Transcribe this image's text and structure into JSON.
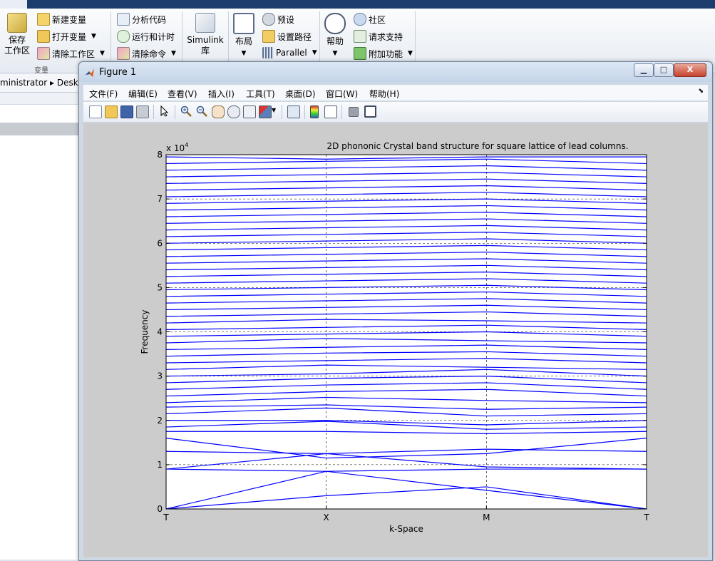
{
  "ribbon": {
    "variable_group": {
      "save_workspace": "保存\n工作区",
      "new_variable": "新建变量",
      "open_variable": "打开变量",
      "clear_workspace": "清除工作区",
      "group_label": "变量"
    },
    "code_group": {
      "analyze_code": "分析代码",
      "run_and_time": "运行和计时",
      "clear_commands": "清除命令"
    },
    "simulink": {
      "label_line1": "Simulink",
      "label_line2": "库"
    },
    "env_group": {
      "layout": "布局",
      "preferences": "预设",
      "set_path": "设置路径",
      "parallel": "Parallel"
    },
    "resources_group": {
      "help": "帮助",
      "community": "社区",
      "request_support": "请求支持",
      "addons": "附加功能"
    }
  },
  "path_bar": {
    "text": "ministrator ▸ Desk"
  },
  "figure_window": {
    "title": "Figure 1",
    "controls": {
      "minimize": "▁",
      "maximize": "□",
      "close": "X"
    },
    "menus": [
      "文件(F)",
      "编辑(E)",
      "查看(V)",
      "插入(I)",
      "工具(T)",
      "桌面(D)",
      "窗口(W)",
      "帮助(H)"
    ],
    "toolbar_icons": [
      "new-figure-icon",
      "open-file-icon",
      "save-icon",
      "print-icon",
      "select-arrow-icon",
      "zoom-in-icon",
      "zoom-out-icon",
      "pan-hand-icon",
      "rotate-3d-icon",
      "data-cursor-icon",
      "brush-icon",
      "link-plot-icon",
      "colorbar-icon",
      "legend-icon",
      "hide-plot-tools-icon",
      "show-plot-tools-icon"
    ]
  },
  "chart_data": {
    "type": "line",
    "title": "2D phononic Crystal band structure for square lattice of lead columns.",
    "xlabel": "k-Space",
    "ylabel": "Frequency",
    "exponent_label": "x 10",
    "exponent_power": "4",
    "x_tick_labels": [
      "T",
      "X",
      "M",
      "T"
    ],
    "x": [
      0,
      1,
      2,
      3
    ],
    "ylim": [
      0,
      80000
    ],
    "y_ticks": [
      0,
      10000,
      20000,
      30000,
      40000,
      50000,
      60000,
      70000,
      80000
    ],
    "y_tick_labels": [
      "0",
      "1",
      "2",
      "3",
      "4",
      "5",
      "6",
      "7",
      "8"
    ],
    "grid": true,
    "line_color": "#0000ff",
    "series": [
      {
        "values": [
          0,
          3000,
          5000,
          0
        ]
      },
      {
        "values": [
          0,
          8500,
          4200,
          0
        ]
      },
      {
        "values": [
          9000,
          8500,
          9000,
          9000
        ]
      },
      {
        "values": [
          9000,
          12500,
          9500,
          9000
        ]
      },
      {
        "values": [
          13000,
          12500,
          13500,
          13000
        ]
      },
      {
        "values": [
          16000,
          11500,
          12500,
          16000
        ]
      },
      {
        "values": [
          17500,
          17500,
          17000,
          17500
        ]
      },
      {
        "values": [
          18500,
          19800,
          18000,
          18500
        ]
      },
      {
        "values": [
          20000,
          20000,
          19000,
          20000
        ]
      },
      {
        "values": [
          21500,
          22800,
          21000,
          21500
        ]
      },
      {
        "values": [
          23000,
          23500,
          22500,
          23000
        ]
      },
      {
        "values": [
          24000,
          25200,
          24500,
          24000
        ]
      },
      {
        "values": [
          25500,
          26500,
          27000,
          25500
        ]
      },
      {
        "values": [
          27000,
          28000,
          28500,
          27000
        ]
      },
      {
        "values": [
          28500,
          29500,
          30000,
          28500
        ]
      },
      {
        "values": [
          30000,
          30500,
          31500,
          30000
        ]
      },
      {
        "values": [
          31500,
          32500,
          32000,
          31500
        ]
      },
      {
        "values": [
          33000,
          33500,
          34000,
          33000
        ]
      },
      {
        "values": [
          34500,
          35200,
          35500,
          34500
        ]
      },
      {
        "values": [
          36000,
          36500,
          37000,
          36000
        ]
      },
      {
        "values": [
          37500,
          38500,
          38000,
          37500
        ]
      },
      {
        "values": [
          39000,
          39500,
          40000,
          39000
        ]
      },
      {
        "values": [
          40500,
          41000,
          41500,
          40500
        ]
      },
      {
        "values": [
          42000,
          42800,
          42500,
          42000
        ]
      },
      {
        "values": [
          43500,
          44000,
          44500,
          43500
        ]
      },
      {
        "values": [
          45000,
          45500,
          46000,
          45000
        ]
      },
      {
        "values": [
          46500,
          47000,
          47500,
          46500
        ]
      },
      {
        "values": [
          48000,
          48500,
          49000,
          48000
        ]
      },
      {
        "values": [
          49500,
          50000,
          50500,
          49500
        ]
      },
      {
        "values": [
          51000,
          51500,
          52000,
          51000
        ]
      },
      {
        "values": [
          52500,
          53000,
          53500,
          52500
        ]
      },
      {
        "values": [
          54000,
          54500,
          55000,
          54000
        ]
      },
      {
        "values": [
          55500,
          56000,
          56500,
          55500
        ]
      },
      {
        "values": [
          57000,
          57500,
          58000,
          57000
        ]
      },
      {
        "values": [
          58500,
          59000,
          59500,
          58500
        ]
      },
      {
        "values": [
          60000,
          60500,
          61000,
          60000
        ]
      },
      {
        "values": [
          61500,
          62000,
          62500,
          61500
        ]
      },
      {
        "values": [
          63000,
          63500,
          64000,
          63000
        ]
      },
      {
        "values": [
          64500,
          65000,
          65500,
          64500
        ]
      },
      {
        "values": [
          66000,
          66500,
          67000,
          66000
        ]
      },
      {
        "values": [
          67500,
          68000,
          68500,
          67500
        ]
      },
      {
        "values": [
          69000,
          69500,
          70000,
          69000
        ]
      },
      {
        "values": [
          70500,
          71000,
          71500,
          70500
        ]
      },
      {
        "values": [
          72000,
          72500,
          73000,
          72000
        ]
      },
      {
        "values": [
          73500,
          74000,
          74500,
          73500
        ]
      },
      {
        "values": [
          75000,
          75500,
          76000,
          75000
        ]
      },
      {
        "values": [
          76500,
          77000,
          77500,
          76500
        ]
      },
      {
        "values": [
          78000,
          78500,
          79000,
          78000
        ]
      },
      {
        "values": [
          79500,
          79000,
          79500,
          79500
        ]
      }
    ]
  }
}
